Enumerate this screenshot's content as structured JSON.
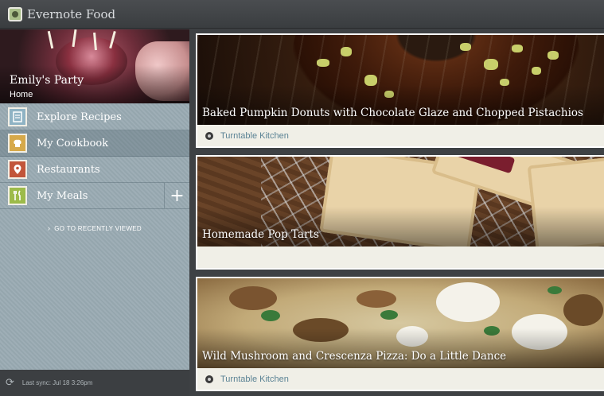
{
  "app": {
    "title": "Evernote Food"
  },
  "sidebar": {
    "hero": {
      "title": "Emily's Party",
      "subtitle": "Home"
    },
    "items": [
      {
        "label": "Explore Recipes",
        "icon": "recipe-book-icon"
      },
      {
        "label": "My Cookbook",
        "icon": "chef-hat-icon"
      },
      {
        "label": "Restaurants",
        "icon": "map-pin-icon"
      },
      {
        "label": "My Meals",
        "icon": "fork-knife-icon",
        "action": "+"
      }
    ],
    "active_index": 1,
    "recent_link": "GO TO RECENTLY VIEWED",
    "recent_chevron": "›",
    "sync": {
      "icon": "sync-icon",
      "text": "Last sync: Jul 18 3:26pm"
    }
  },
  "cards": [
    {
      "title": "Baked Pumpkin Donuts with Chocolate Glaze and Chopped Pistachios",
      "source": "Turntable Kitchen"
    },
    {
      "title": "Homemade Pop Tarts",
      "source": ""
    },
    {
      "title": "Wild Mushroom and Crescenza Pizza: Do a Little Dance",
      "source": "Turntable Kitchen"
    }
  ],
  "colors": {
    "sidebar": "#9aabb3",
    "source_link": "#5a8294",
    "icon_bg_recipes": "#8fb3c4",
    "icon_bg_cookbook": "#d6a94a",
    "icon_bg_restaurants": "#c2553a",
    "icon_bg_meals": "#9dbb4a"
  }
}
